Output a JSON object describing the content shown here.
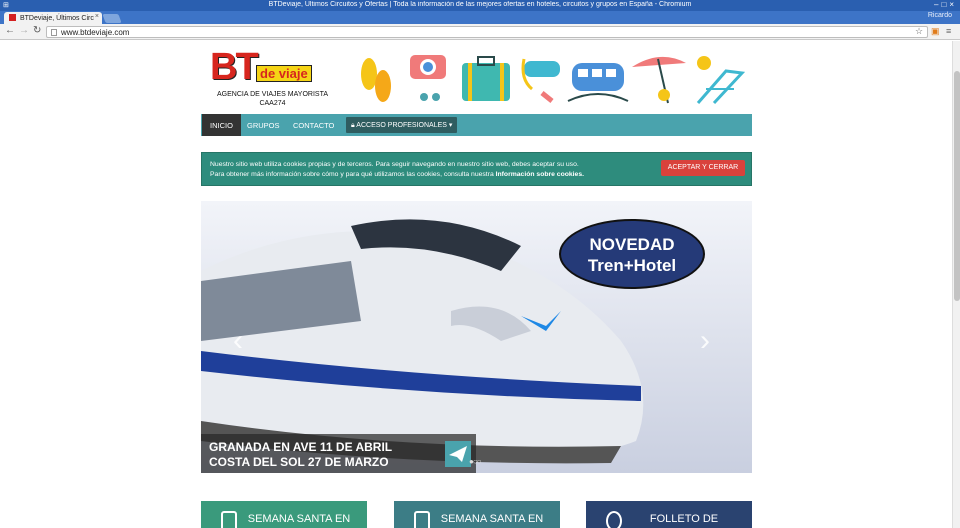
{
  "window": {
    "title": "BTDeviaje, Últimos Circuitos y Ofertas | Toda la información de las mejores ofertas en hoteles, circuitos y grupos en España - Chromium",
    "profile": "Ricardo"
  },
  "tabs": [
    {
      "label": "BTDeviaje, Últimos Circ",
      "close": "×"
    }
  ],
  "toolbar": {
    "url": "www.btdeviaje.com"
  },
  "logo": {
    "bt": "BT",
    "de_viaje": "de viaje",
    "line1": "AGENCIA DE VIAJES MAYORISTA",
    "line2": "CAA274"
  },
  "nav": {
    "items": [
      "INICIO",
      "GRUPOS",
      "CONTACTO"
    ],
    "acceso": "ACCESO PROFESIONALES"
  },
  "cookie": {
    "line1": "Nuestro sitio web utiliza cookies propias y de terceros. Para seguir navegando en nuestro sitio web, debes aceptar su uso.",
    "line2": "Para obtener más información sobre cómo y para qué utilizamos las cookies, consulta nuestra",
    "link": "Información sobre cookies.",
    "button": "ACEPTAR Y CERRAR"
  },
  "slider": {
    "badge_line1": "NOVEDAD",
    "badge_line2": "Tren+Hotel",
    "caption_line1": "GRANADA EN AVE 11 DE ABRIL",
    "caption_line2": "COSTA DEL SOL 27 DE MARZO",
    "prev": "‹",
    "next": "›"
  },
  "boxes": [
    {
      "label": "SEMANA SANTA EN",
      "color": "#3a9a7c"
    },
    {
      "label": "SEMANA SANTA EN",
      "color": "#3c7d86"
    },
    {
      "label": "FOLLETO DE",
      "color": "#2a4370"
    }
  ]
}
